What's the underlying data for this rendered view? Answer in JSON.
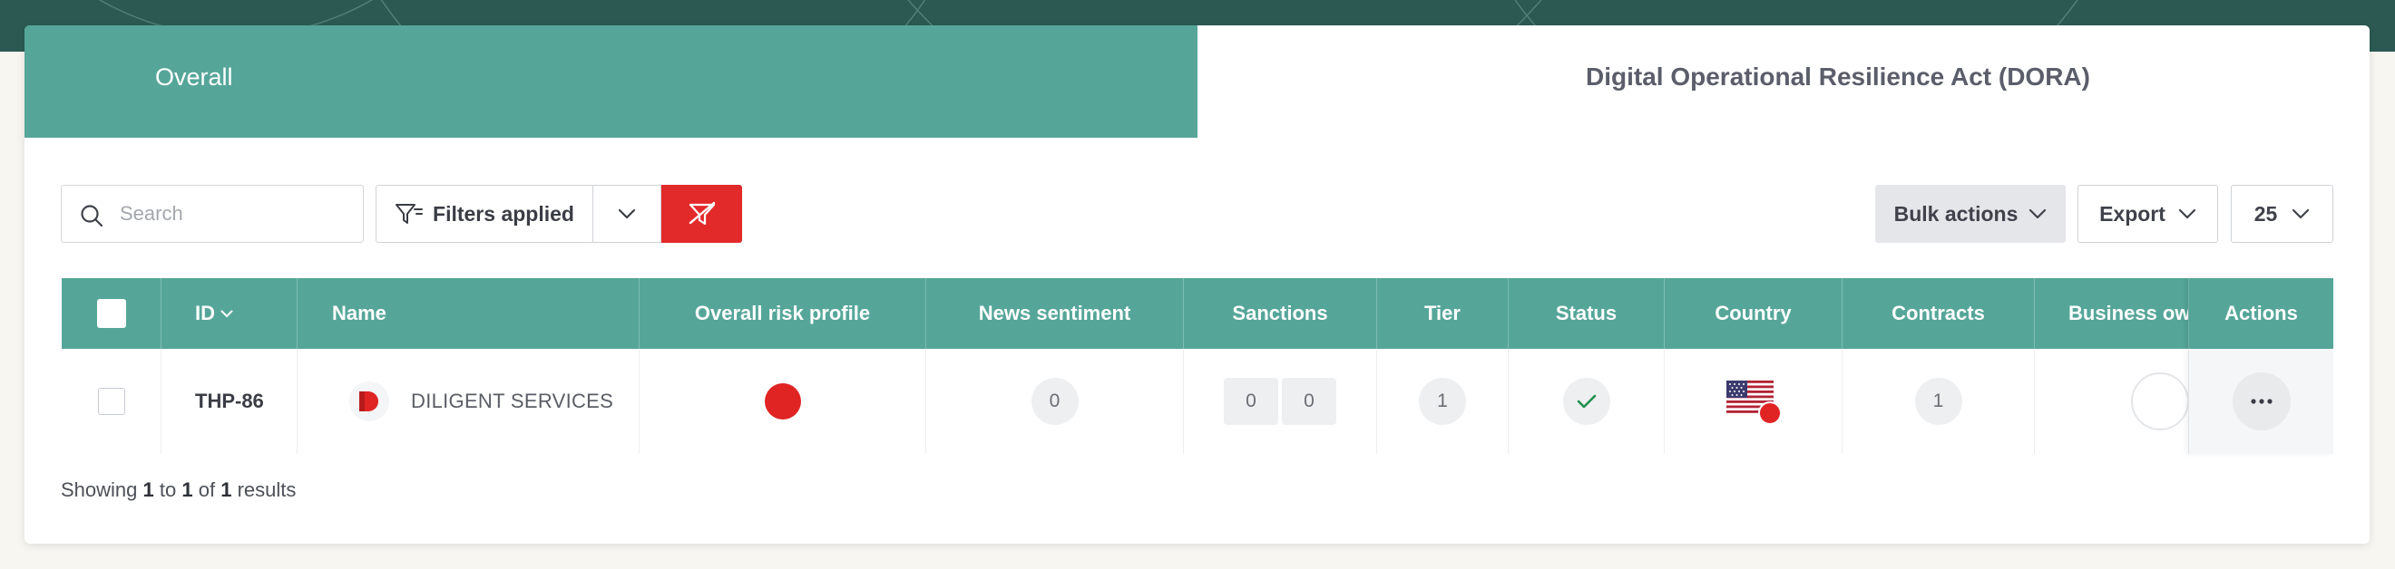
{
  "tabs": {
    "overall": "Overall",
    "dora": "Digital Operational Resilience Act (DORA)"
  },
  "toolbar": {
    "search_placeholder": "Search",
    "filters_label": "Filters applied",
    "bulk_actions_label": "Bulk actions",
    "export_label": "Export",
    "per_page": "25"
  },
  "table": {
    "columns": {
      "id": "ID",
      "name": "Name",
      "risk": "Overall risk profile",
      "news": "News sentiment",
      "sanctions": "Sanctions",
      "tier": "Tier",
      "status": "Status",
      "country": "Country",
      "contracts": "Contracts",
      "owner": "Business owner",
      "actions": "Actions"
    },
    "rows": [
      {
        "id": "THP-86",
        "name": "DILIGENT SERVICES",
        "risk_color": "#e02424",
        "news": "0",
        "sanctions_a": "0",
        "sanctions_b": "0",
        "tier": "1",
        "status_icon": "check-icon",
        "country_icon": "us-flag-icon",
        "contracts": "1"
      }
    ]
  },
  "footer": {
    "showing": "Showing",
    "from": "1",
    "to_word": "to",
    "to": "1",
    "of_word": "of",
    "total": "1",
    "results": "results"
  },
  "colors": {
    "header_band": "#2c5a52",
    "accent": "#55a699",
    "danger": "#e22a2a"
  }
}
